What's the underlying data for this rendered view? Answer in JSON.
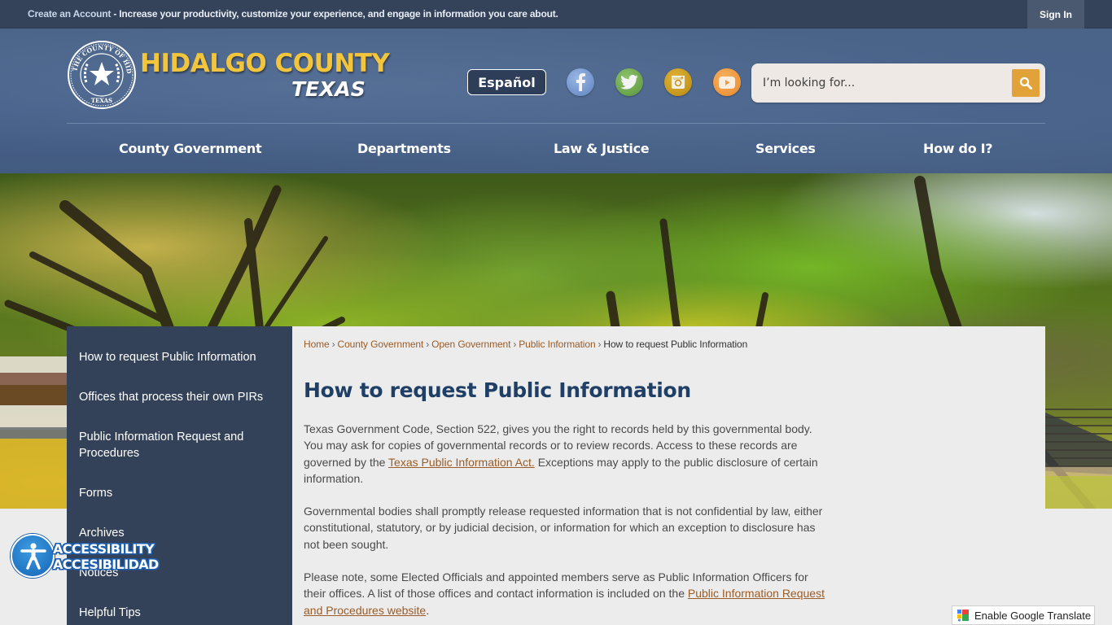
{
  "topbar": {
    "create_account_link": "Create an Account",
    "message": " - Increase your productivity, customize your experience, and engage in information you care about.",
    "sign_in": "Sign In"
  },
  "header": {
    "logo_title": "HIDALGO COUNTY",
    "logo_subtitle": "TEXAS",
    "seal_top_text": "THE COUNTY OF HIDALGO",
    "seal_bottom_text": "TEXAS",
    "language_button": "Español",
    "social": [
      {
        "name": "facebook",
        "icon": "facebook-icon",
        "color": "#6d8fc9"
      },
      {
        "name": "twitter",
        "icon": "twitter-icon",
        "color": "#6ba64d"
      },
      {
        "name": "instagram",
        "icon": "instagram-icon",
        "color": "#c99a1e"
      },
      {
        "name": "youtube",
        "icon": "youtube-icon",
        "color": "#ef9a40"
      }
    ],
    "search": {
      "placeholder": "I’m looking for...",
      "value": "",
      "button_icon": "search-icon",
      "button_color": "#e2a23a"
    }
  },
  "nav": {
    "items": [
      {
        "label": "County Government"
      },
      {
        "label": "Departments"
      },
      {
        "label": "Law & Justice"
      },
      {
        "label": "Services"
      },
      {
        "label": "How do I?"
      }
    ]
  },
  "sidebar": {
    "items": [
      {
        "label": "How to request Public Information"
      },
      {
        "label": "Offices that process their own PIRs"
      },
      {
        "label": "Public Information Request and Procedures"
      },
      {
        "label": "Forms"
      },
      {
        "label": "Archives"
      },
      {
        "label": "Notices"
      },
      {
        "label": "Helpful Tips"
      }
    ]
  },
  "breadcrumb": {
    "items": [
      {
        "label": "Home"
      },
      {
        "label": "County Government"
      },
      {
        "label": "Open Government"
      },
      {
        "label": "Public Information"
      }
    ],
    "separator": "›",
    "current": "How to request Public Information"
  },
  "content": {
    "title": "How to request Public Information",
    "p1_before": "Texas Government Code, Section 522, gives you the right to records held by this governmental body. You may ask for copies of governmental records or to review records. Access to these records are governed by the ",
    "p1_link": "Texas Public Information Act.",
    "p1_after": " Exceptions may apply to the public disclosure of certain information.",
    "p2": "Governmental bodies shall promptly release requested information that is not confidential by law, either constitutional, statutory, or by judicial decision, or information for which an exception to disclosure has not been sought.",
    "p3_before": "Please note, some Elected Officials and appointed members serve as Public Information Officers for their offices. A list of those offices and contact information is included on the ",
    "p3_link": "Public Information Request and Procedures website",
    "p3_after": "."
  },
  "accessibility": {
    "line1": "ACCESSIBILITY",
    "line2": "ACCESIBILIDAD"
  },
  "google_translate": {
    "label": "Enable Google Translate"
  },
  "colors": {
    "topbar": "#34435a",
    "header": "#46608a",
    "sidebar": "#344259",
    "title": "#1f3f66",
    "link": "#9a5c28",
    "logo_gold": "#f3c53d"
  }
}
